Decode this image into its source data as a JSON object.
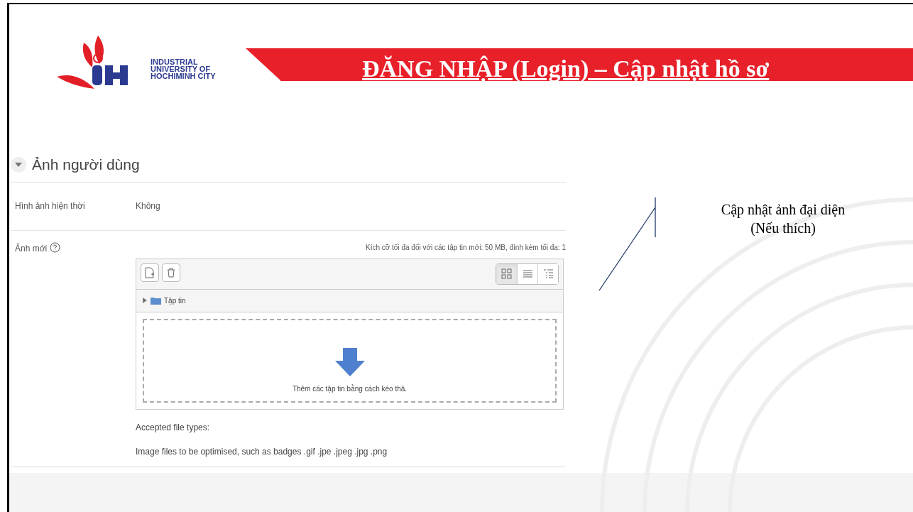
{
  "logo": {
    "lines": [
      "INDUSTRIAL",
      "UNIVERSITY OF",
      "HOCHIMINH CITY"
    ]
  },
  "title": "ĐĂNG NHẬP (Login) – Cập nhật hồ sơ",
  "section": {
    "title": "Ảnh người dùng",
    "expanded": true,
    "rows": [
      {
        "label": "Hình ảnh hiện thời",
        "value": "Không"
      }
    ],
    "upload": {
      "label": "Ảnh mới",
      "limits": "Kích cỡ tối đa đối với các tập tin mới: 50 MB, đính kèm tối đa: 1",
      "views": [
        {
          "kind": "icons",
          "selected": true
        },
        {
          "kind": "list",
          "selected": false
        },
        {
          "kind": "tree",
          "selected": false
        }
      ],
      "folder": {
        "name": "Tập tin",
        "expanded": false
      },
      "drop_text": "Thêm các tập tin bằng cách kéo thả.",
      "accepted_label": "Accepted file types:",
      "accepted_types": "Image files to be optimised, such as badges .gif .jpe .jpeg .jpg .png"
    }
  },
  "callout": [
    "Cập nhật ảnh đại diện",
    "(Nếu thích)"
  ]
}
